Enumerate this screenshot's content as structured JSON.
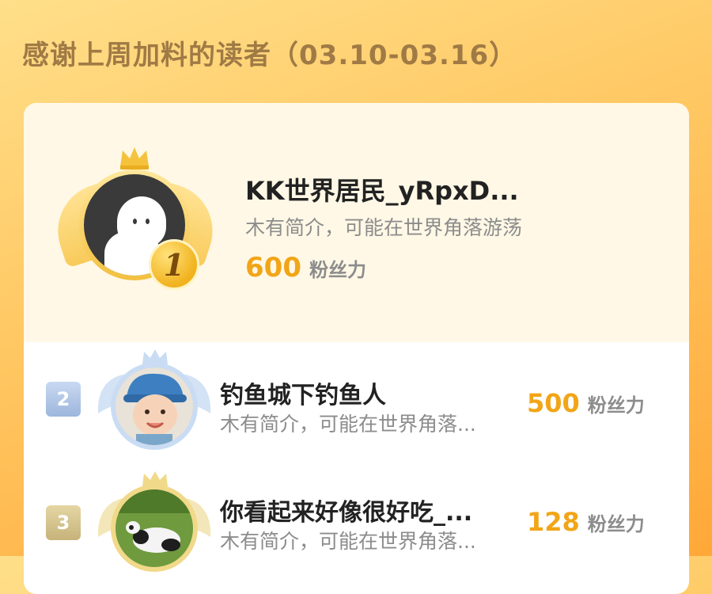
{
  "header": {
    "title": "感谢上周加料的读者（03.10-03.16）"
  },
  "top_reader": {
    "rank": "1",
    "name": "KK世界居民_yRpxD...",
    "intro": "木有简介，可能在世界角落游荡",
    "score": "600",
    "score_unit": "粉丝力",
    "avatar_icon": "ghost-avatar-icon",
    "medal_color": "#f1b21e"
  },
  "readers": [
    {
      "rank": "2",
      "name": "钓鱼城下钓鱼人",
      "intro": "木有简介，可能在世界角落...",
      "score": "500",
      "score_unit": "粉丝力",
      "badge_color": "#9db6dd"
    },
    {
      "rank": "3",
      "name": "你看起来好像很好吃_...",
      "intro": "木有简介，可能在世界角落...",
      "score": "128",
      "score_unit": "粉丝力",
      "badge_color": "#c7b37a"
    }
  ],
  "colors": {
    "accent": "#f1a517",
    "title": "#a07a45"
  }
}
